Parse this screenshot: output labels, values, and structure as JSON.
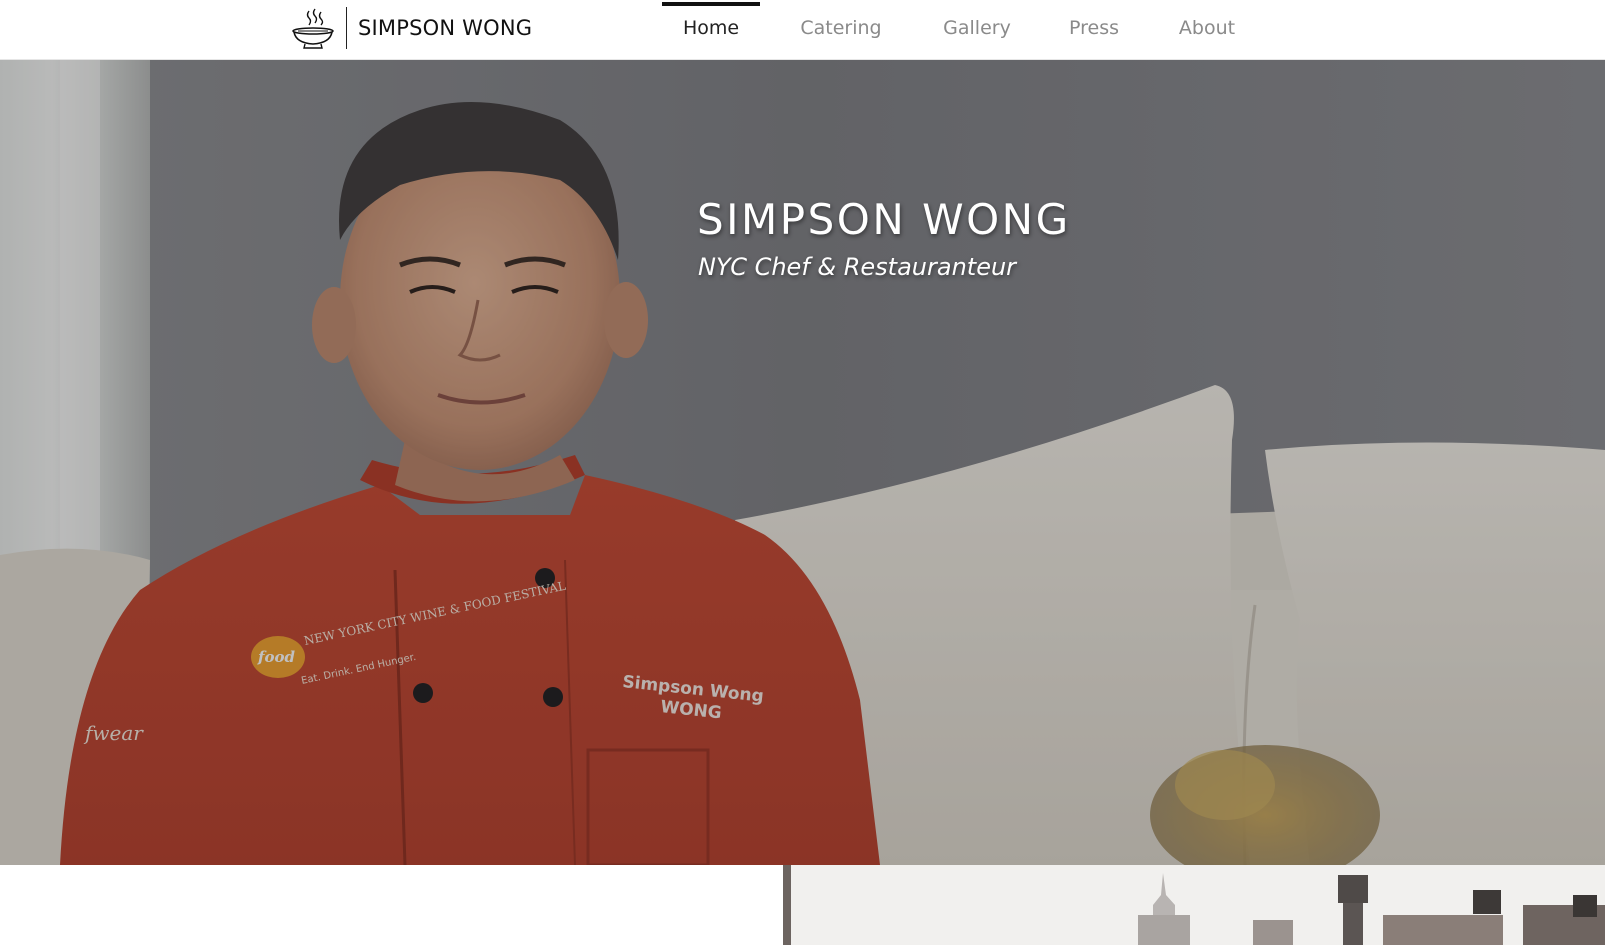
{
  "site": {
    "logo_text": "SIMPSON WONG",
    "logo_icon": "steaming-bowl-icon"
  },
  "nav": {
    "items": [
      {
        "label": "Home",
        "active": true
      },
      {
        "label": "Catering",
        "active": false
      },
      {
        "label": "Gallery",
        "active": false
      },
      {
        "label": "Press",
        "active": false
      },
      {
        "label": "About",
        "active": false
      }
    ]
  },
  "hero": {
    "title": "SIMPSON WONG",
    "subtitle": "NYC Chef & Restauranteur",
    "jacket_embroidery_line1": "Simpson Wong",
    "jacket_embroidery_line2": "WONG",
    "patch_logo": "food",
    "patch_festival": "NEW YORK CITY WINE & FOOD FESTIVAL",
    "patch_tagline": "Eat. Drink. End Hunger.",
    "sleeve_logo": "fwear"
  },
  "colors": {
    "nav_active": "#222222",
    "nav_inactive": "#8a8a8a",
    "jacket_red": "#b8412c",
    "hero_overlay": "rgba(30,30,34,0.28)"
  }
}
